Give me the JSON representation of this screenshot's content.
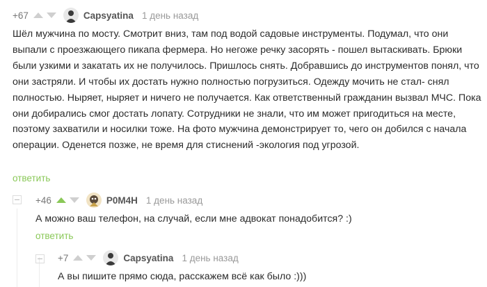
{
  "comments": [
    {
      "rating": "+67",
      "author": "Capsyatina",
      "time": "1 день назад",
      "text": "Шёл мужчина по мосту. Смотрит вниз, там под водой садовые инструменты. Подумал, что они выпали с проезжающего пикапа фермера. Но негоже речку засорять - пошел вытаскивать. Брюки были узкими и закатать их не получилось. Пришлось снять. Добравшись до инструментов понял, что они застряли. И чтобы их достать нужно полностью погрузиться. Одежду мочить не стал- снял полностью. Ныряет, ныряет и ничего не получается. Как ответственный гражданин вызвал МЧС. Пока они добирались смог достать лопату. Сотрудники не знали, что им может пригодиться на месте, поэтому захватили и носилки тоже. На фото мужчина демонстрирует то, чего он добился с начала операции. Оденется позже, не время для стиснений -экология под угрозой.",
      "reply": "ответить"
    },
    {
      "rating": "+46",
      "author": "P0M4H",
      "time": "1 день назад",
      "text": "А можно ваш телефон, на случай, если мне адвокат понадобится? :)",
      "reply": "ответить"
    },
    {
      "rating": "+7",
      "author": "Capsyatina",
      "time": "1 день назад",
      "text": "А вы пишите прямо сюда, расскажем всё как было :)))"
    }
  ],
  "colors": {
    "accent": "#8ac858",
    "author": "#555555",
    "meta": "#999999"
  }
}
